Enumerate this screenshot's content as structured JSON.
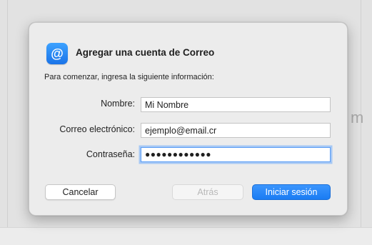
{
  "background": {
    "hint_char": "m"
  },
  "dialog": {
    "app_icon_glyph": "@",
    "icon_name": "mail-at-icon",
    "title": "Agregar una cuenta de Correo",
    "subtitle": "Para comenzar, ingresa la siguiente información:",
    "fields": {
      "name": {
        "label": "Nombre:",
        "value": "Mi Nombre"
      },
      "email": {
        "label": "Correo electrónico:",
        "value": "ejemplo@email.cr"
      },
      "password": {
        "label": "Contraseña:",
        "value": "●●●●●●●●●●●●"
      }
    },
    "buttons": {
      "cancel": "Cancelar",
      "back": "Atrás",
      "sign_in": "Iniciar sesión"
    }
  },
  "colors": {
    "accent": "#1a7cf3",
    "focus_ring": "#a6c8f5",
    "sheet_bg": "#ececec"
  }
}
